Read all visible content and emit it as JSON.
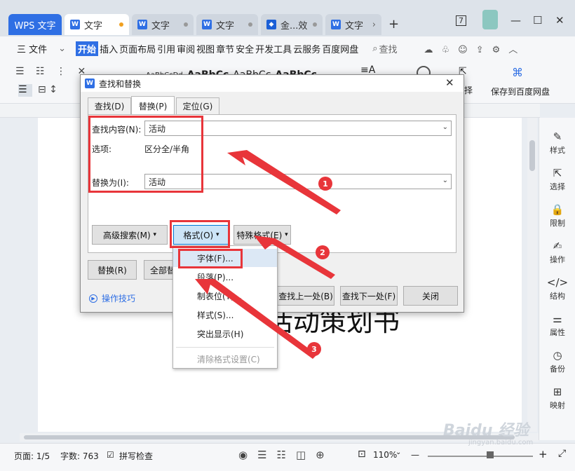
{
  "titlebar": {
    "wps_label": "WPS 文字",
    "tabs": [
      "文字",
      "文字",
      "文字",
      "金...效",
      "文字"
    ],
    "add_tab": "+",
    "badge": "7",
    "min": "—",
    "max": "☐",
    "close": "✕"
  },
  "menubar": {
    "file": "三 文件",
    "items": [
      "开始",
      "插入",
      "页面布局",
      "引用",
      "审阅",
      "视图",
      "章节",
      "安全",
      "开发工具",
      "云服务",
      "百度网盘"
    ],
    "search": "查找"
  },
  "ribbon": {
    "styles_preview": [
      "AaBbCcDd",
      "AaBbCc",
      "AaBbCc",
      "AaBbCc"
    ],
    "save_baidu": "保存到百度网盘",
    "select_label": "择"
  },
  "document": {
    "big_text": "活动策划书"
  },
  "right_panel": {
    "items": [
      "样式",
      "选择",
      "限制",
      "操作",
      "结构",
      "属性",
      "备份",
      "映射"
    ]
  },
  "statusbar": {
    "page": "页面: 1/5",
    "words": "字数: 763",
    "spell": "拼写检查",
    "zoom": "110%",
    "zoom_minus": "—",
    "zoom_plus": "+"
  },
  "dialog": {
    "title": "查找和替换",
    "tabs": [
      "查找(D)",
      "替换(P)",
      "定位(G)"
    ],
    "find_label": "查找内容(N):",
    "find_value": "活动",
    "options_label": "选项:",
    "options_value": "区分全/半角",
    "replace_label": "替换为(I):",
    "replace_value": "活动",
    "advanced_btn": "高级搜索(M)",
    "format_btn": "格式(O)",
    "special_btn": "特殊格式(E)",
    "replace_btn": "替换(R)",
    "replace_all_btn": "全部替",
    "tips_link": "操作技巧",
    "find_prev_btn": "查找上一处(B)",
    "find_next_btn": "查找下一处(F)",
    "close_btn": "关闭"
  },
  "format_menu": {
    "items": [
      "字体(F)...",
      "段落(P)...",
      "制表位(T)...",
      "样式(S)...",
      "突出显示(H)",
      "清除格式设置(C)"
    ]
  },
  "annotations": {
    "badges": [
      "1",
      "2",
      "3"
    ],
    "color": "#e8353a"
  },
  "watermark": {
    "text": "Baidu 经验",
    "sub": "jingyan.baidu.com"
  }
}
